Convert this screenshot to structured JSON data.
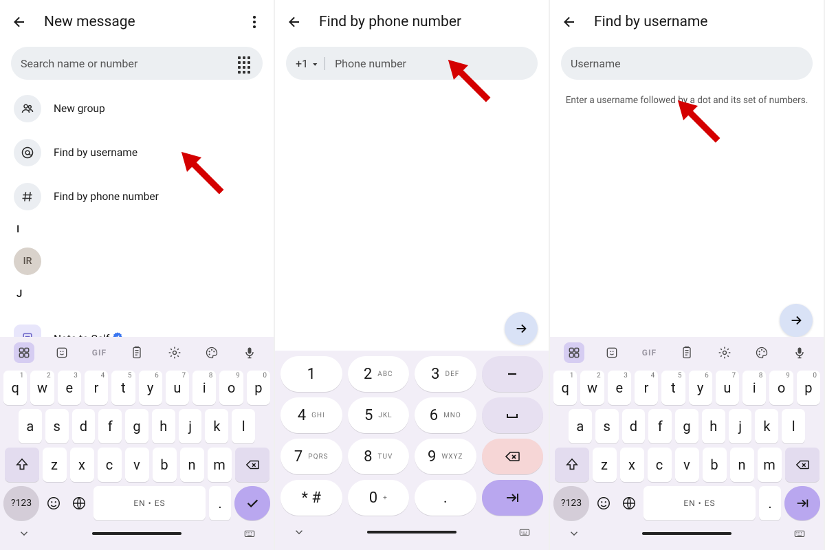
{
  "pane1": {
    "title": "New message",
    "search_placeholder": "Search name or number",
    "items": {
      "new_group": "New group",
      "find_username": "Find by username",
      "find_phone": "Find by phone number"
    },
    "section1": "I",
    "contact1_initials": "IR",
    "section2": "J",
    "note_to_self": "Note to Self"
  },
  "pane2": {
    "title": "Find by phone number",
    "cc": "+1",
    "placeholder": "Phone number"
  },
  "pane3": {
    "title": "Find by username",
    "placeholder": "Username",
    "hint": "Enter a username followed by a dot and its set of numbers."
  },
  "qwerty": {
    "row1": [
      "q",
      "w",
      "e",
      "r",
      "t",
      "y",
      "u",
      "i",
      "o",
      "p"
    ],
    "row1_sup": [
      "1",
      "2",
      "3",
      "4",
      "5",
      "6",
      "7",
      "8",
      "9",
      "0"
    ],
    "row2": [
      "a",
      "s",
      "d",
      "f",
      "g",
      "h",
      "j",
      "k",
      "l"
    ],
    "row3": [
      "z",
      "x",
      "c",
      "v",
      "b",
      "n",
      "m"
    ],
    "sym": "?123",
    "space": "EN • ES",
    "dot": "."
  },
  "toolbar_gif": "GIF",
  "numpad": {
    "r1": [
      {
        "n": "1",
        "s": ""
      },
      {
        "n": "2",
        "s": "ABC"
      },
      {
        "n": "3",
        "s": "DEF"
      }
    ],
    "r2": [
      {
        "n": "4",
        "s": "GHI"
      },
      {
        "n": "5",
        "s": "JKL"
      },
      {
        "n": "6",
        "s": "MNO"
      }
    ],
    "r3": [
      {
        "n": "7",
        "s": "PQRS"
      },
      {
        "n": "8",
        "s": "TUV"
      },
      {
        "n": "9",
        "s": "WXYZ"
      }
    ],
    "r4": [
      {
        "n": "* #",
        "s": ""
      },
      {
        "n": "0",
        "s": "+"
      },
      {
        "n": ".",
        "s": ""
      }
    ]
  }
}
